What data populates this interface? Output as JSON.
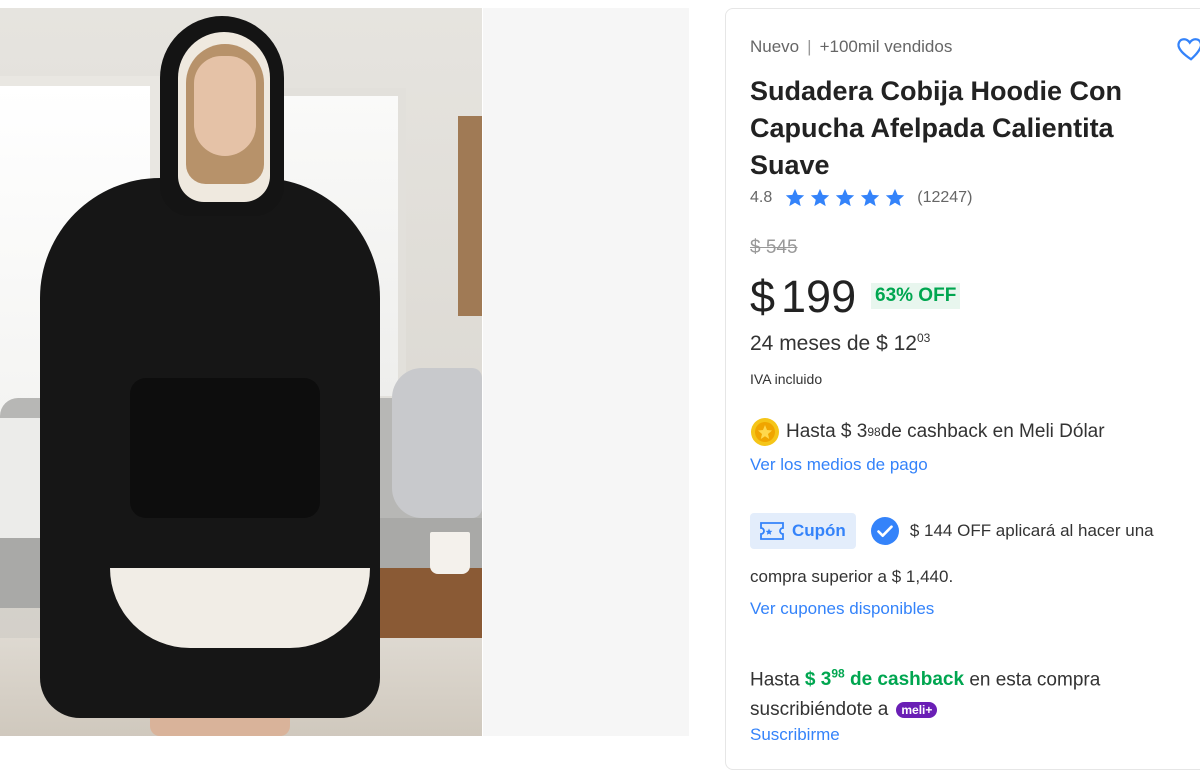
{
  "gallery": {
    "image_alt": "Sudadera Cobija Hoodie negra"
  },
  "product": {
    "condition": "Nuevo",
    "sold": "+100mil vendidos",
    "title": "Sudadera Cobija Hoodie Con Capucha Afelpada Calientita Suave",
    "rating": "4.8",
    "rating_stars": 5,
    "reviews_count": "(12247)",
    "favorite_icon": "heart-icon"
  },
  "pricing": {
    "original_price": "$ 545",
    "currency": "$",
    "price": "199",
    "discount": "63% OFF",
    "installments_prefix": "24 meses de $ 12",
    "installments_cents": "03",
    "tax_note": "IVA incluido"
  },
  "cashback": {
    "prefix": "Hasta $ 3",
    "cents": "98",
    "suffix": " de cashback en Meli Dólar",
    "icon": "coin-icon",
    "payment_link": "Ver los medios de pago"
  },
  "coupon": {
    "label": "Cupón",
    "description_line1": "$ 144 OFF aplicará al hacer una",
    "description_line2": "compra superior a $ 1,440.",
    "link": "Ver cupones disponibles",
    "accent_color": "#3483fa"
  },
  "meli_plus": {
    "prefix": "Hasta ",
    "amount": "$ 3",
    "cents": "98",
    "amount_suffix": " de cashback",
    "suffix": " en esta compra",
    "line2": "suscribiéndote a",
    "badge": "meli+",
    "link": "Suscribirme",
    "badge_color": "#6a1fb5"
  },
  "colors": {
    "link": "#3483fa",
    "success": "#00a650",
    "star": "#3483fa"
  }
}
